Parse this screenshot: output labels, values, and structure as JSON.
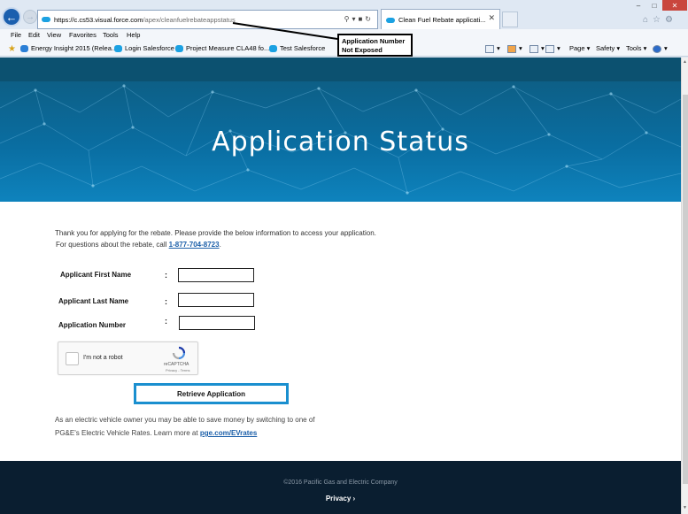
{
  "browser": {
    "address_host": "https://c.cs53.visual.force.com",
    "address_path": "/apex/cleanfuelrebateappstatus",
    "tab_title": "Clean Fuel Rebate applicati...",
    "menu": [
      "File",
      "Edit",
      "View",
      "Favorites",
      "Tools",
      "Help"
    ],
    "favorites": [
      "Energy Insight 2015 (Relea...",
      "Login Salesforce",
      "Project Measure CLA48 fo...",
      "Test Salesforce"
    ],
    "commands": [
      "Page",
      "Safety",
      "Tools"
    ]
  },
  "callout": {
    "line1": "Application Number",
    "line2": "Not Exposed"
  },
  "hero": {
    "title": "Application Status"
  },
  "intro": {
    "line1": "Thank you for applying for the rebate. Please provide the below information to access your application.",
    "call_prefix": "For questions about the rebate, call ",
    "phone": "1-877-704-8723",
    "call_suffix": "."
  },
  "form": {
    "first_name_label": "Applicant First Name",
    "last_name_label": "Applicant Last Name",
    "app_number_label": "Application Number",
    "separator": ":",
    "first_name_value": "",
    "last_name_value": "",
    "app_number_value": ""
  },
  "captcha": {
    "label": "I'm not a robot",
    "brand": "reCAPTCHA",
    "terms": "Privacy - Terms"
  },
  "retrieve_label": "Retrieve Application",
  "ev": {
    "line1": "As an electric vehicle owner you may be able to save money by switching to one of",
    "line2_prefix": "PG&E's Electric Vehicle Rates. Learn more at ",
    "link": "pge.com/EVrates"
  },
  "footer": {
    "copyright": "©2016 Pacific Gas and Electric Company",
    "privacy": "Privacy ›"
  },
  "colors": {
    "hero": "#0a6ea2",
    "accent": "#1a8fcf",
    "footer": "#0a1e30",
    "link": "#1a5ea8"
  }
}
